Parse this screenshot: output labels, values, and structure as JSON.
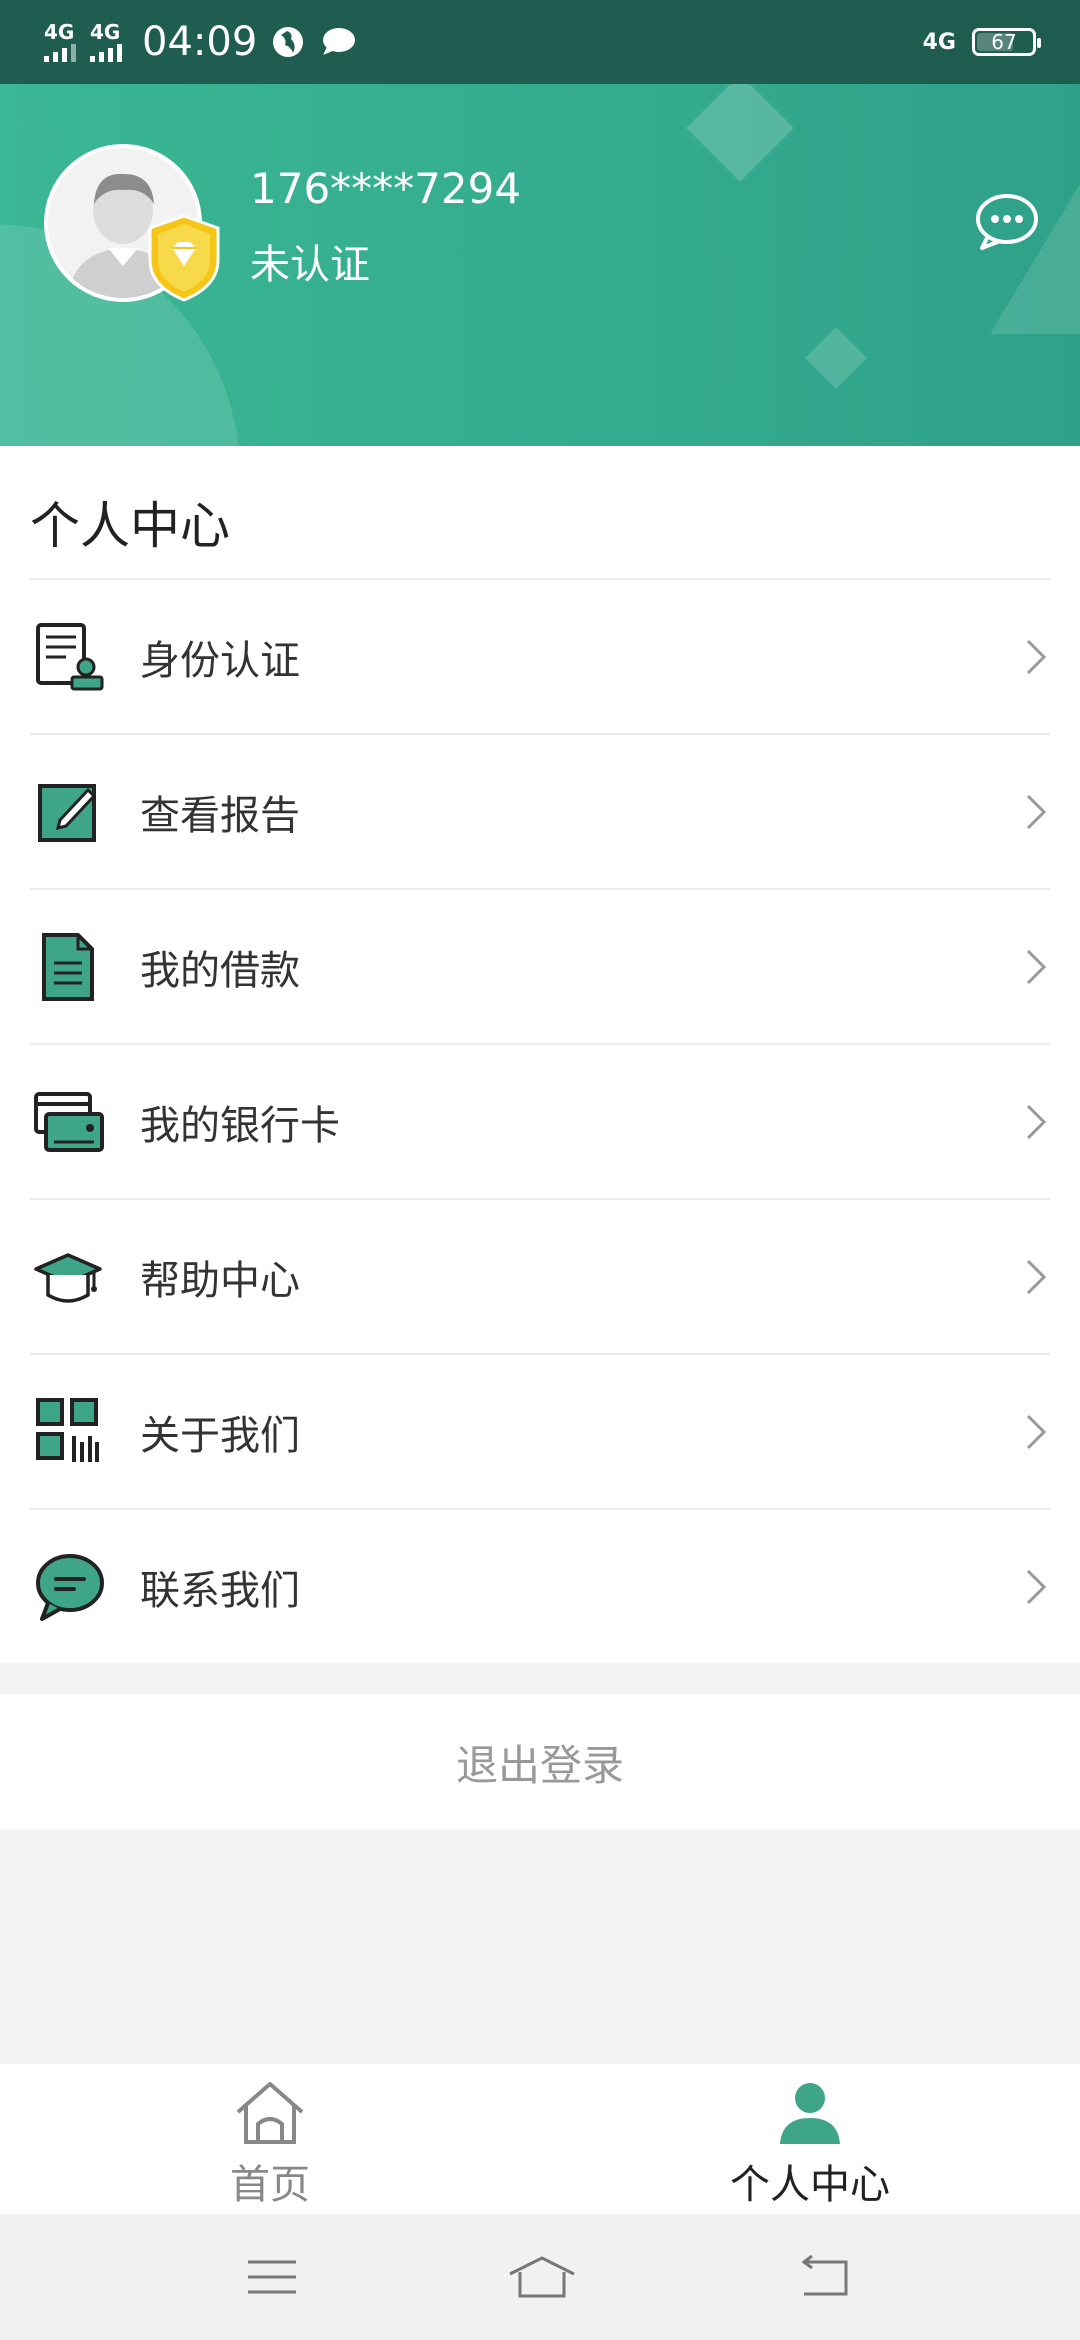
{
  "status_bar": {
    "sim1": "4G",
    "sim2": "4G",
    "time": "04:09",
    "network_right": "4G",
    "battery": "67"
  },
  "profile": {
    "phone": "176****7294",
    "cert_status": "未认证"
  },
  "section_title": "个人中心",
  "menu": {
    "items": [
      {
        "label": "身份认证",
        "icon": "id-verify-icon"
      },
      {
        "label": "查看报告",
        "icon": "edit-report-icon"
      },
      {
        "label": "我的借款",
        "icon": "document-icon"
      },
      {
        "label": "我的银行卡",
        "icon": "bank-card-icon"
      },
      {
        "label": "帮助中心",
        "icon": "graduation-cap-icon"
      },
      {
        "label": "关于我们",
        "icon": "qr-code-icon"
      },
      {
        "label": "联系我们",
        "icon": "chat-bubble-icon"
      }
    ]
  },
  "logout_label": "退出登录",
  "tabs": [
    {
      "label": "首页",
      "icon": "home-icon",
      "active": false
    },
    {
      "label": "个人中心",
      "icon": "person-icon",
      "active": true
    }
  ],
  "colors": {
    "accent": "#2fa189",
    "icon_fill": "#3ea588",
    "header_start": "#3ab794",
    "header_end": "#2fa189",
    "shield": "#f5c518"
  }
}
